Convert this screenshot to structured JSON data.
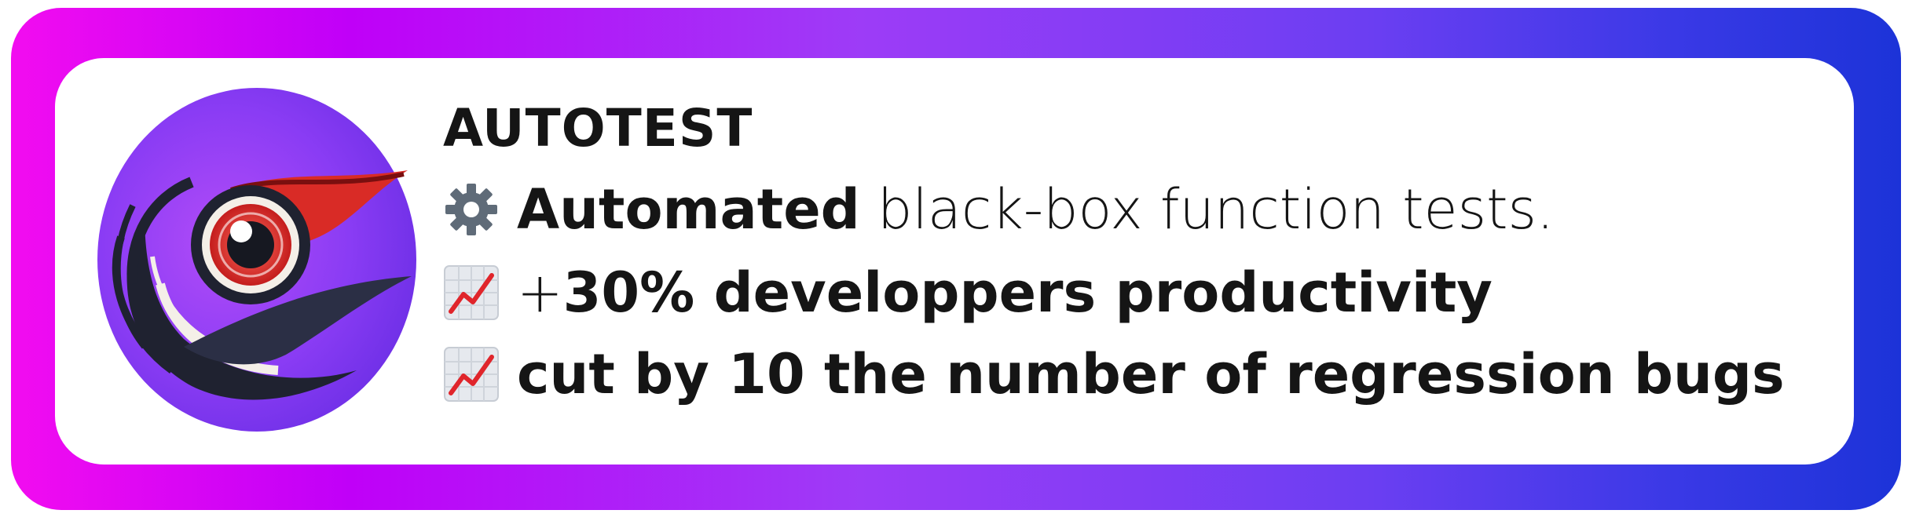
{
  "title": "AUTOTEST",
  "features": [
    {
      "icon": "gear-icon",
      "bold": "Automated",
      "text": " black-box function tests."
    },
    {
      "icon": "chart-increasing-icon",
      "prefix": "+",
      "bold": "30% developpers productivity"
    },
    {
      "icon": "chart-increasing-icon",
      "bold": "cut by 10 the number of regression bugs"
    }
  ],
  "colors": {
    "frame_gradient": [
      "#f20cf0",
      "#c000f8",
      "#9d3cf7",
      "#6b3ef2",
      "#1c33d8"
    ],
    "card_background": "#ffffff",
    "text": "#151515",
    "logo_circle": "#8a3cf4",
    "logo_eye_red": "#e4322b"
  },
  "logo": "bird-eye-logo"
}
